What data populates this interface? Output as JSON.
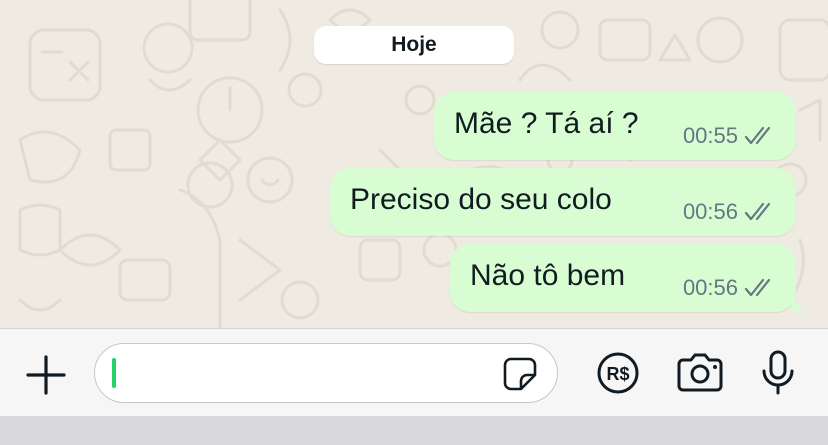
{
  "chat": {
    "date_separator": "Hoje",
    "messages": [
      {
        "text": "Mãe ? Tá aí ?",
        "time": "00:55",
        "status": "read-double-check-icon"
      },
      {
        "text": "Preciso do seu colo",
        "time": "00:56",
        "status": "read-double-check-icon"
      },
      {
        "text": "Não tô bem",
        "time": "00:56",
        "status": "read-double-check-icon"
      }
    ]
  },
  "composer": {
    "placeholder": "",
    "value": "",
    "icons": {
      "plus": "plus-icon",
      "sticker": "sticker-icon",
      "payment": "payment-rs-icon",
      "camera": "camera-icon",
      "microphone": "microphone-icon"
    },
    "payment_label": "R$"
  },
  "colors": {
    "wallpaper": "#efeae2",
    "outgoing_bubble": "#d9fdd3",
    "tick": "#667781",
    "caret": "#25d366",
    "input_bar": "#f6f6f6"
  }
}
